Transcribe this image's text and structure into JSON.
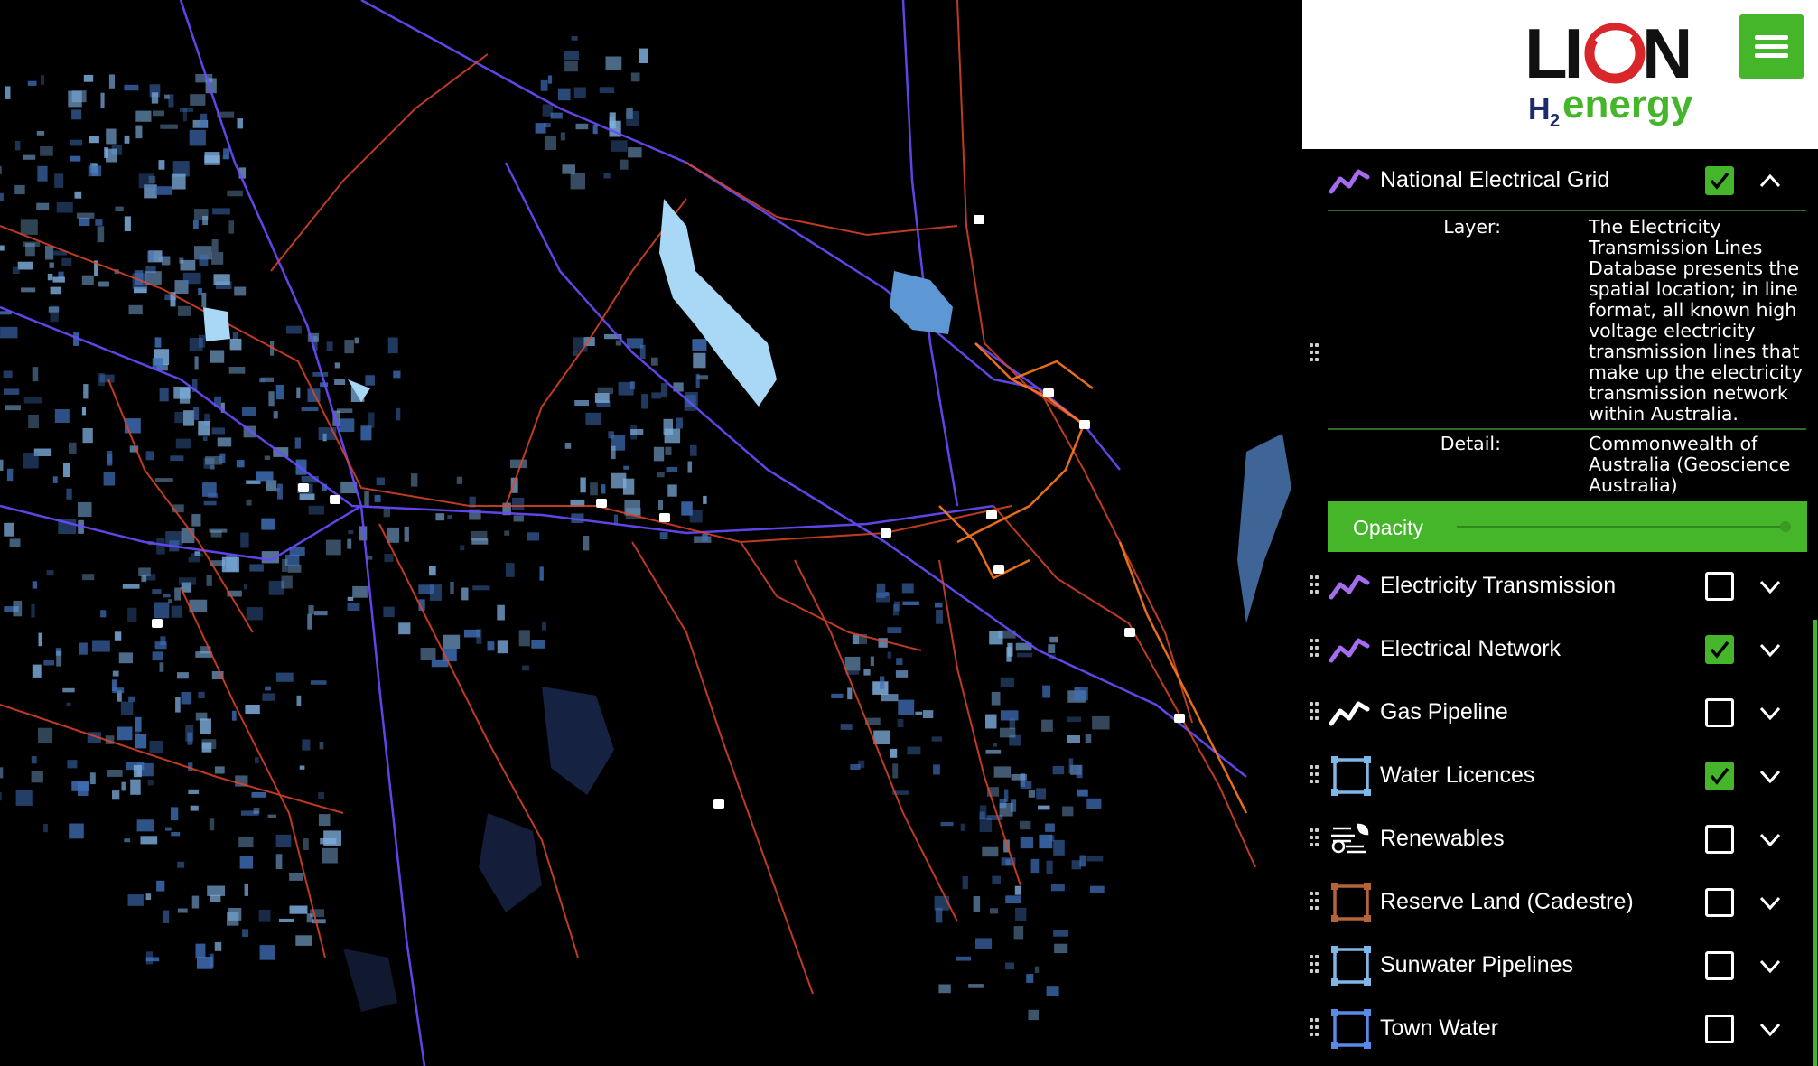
{
  "brand": {
    "name": "LION",
    "sub_h": "H",
    "sub_2": "2",
    "sub_energy": "energy",
    "accent": "#45b52a",
    "logo_red": "#d8262b"
  },
  "menu": {
    "icon": "hamburger-menu-icon"
  },
  "expanded_layer": {
    "name": "National Electrical Grid",
    "checked": true,
    "icon": "line-layer-icon",
    "icon_color": "#a66cf0",
    "layer_label": "Layer:",
    "layer_lines": [
      "The Electricity",
      "Transmission Lines",
      "Database presents the",
      "spatial location; in line",
      "format, all known high",
      "voltage electricity",
      "transmission lines that",
      "make up the electricity",
      "transmission network",
      "within Australia."
    ],
    "detail_label": "Detail:",
    "detail_lines": [
      "Commonwealth of",
      "Australia (Geoscience",
      "Australia)"
    ],
    "opacity_label": "Opacity",
    "opacity": 1.0
  },
  "layers": [
    {
      "name": "Electricity Transmission",
      "checked": false,
      "icon": "line-layer-icon",
      "icon_color": "#a66cf0"
    },
    {
      "name": "Electrical Network",
      "checked": true,
      "icon": "line-layer-icon",
      "icon_color": "#a66cf0"
    },
    {
      "name": "Gas Pipeline",
      "checked": false,
      "icon": "line-layer-icon",
      "icon_color": "#ffffff"
    },
    {
      "name": "Water Licences",
      "checked": true,
      "icon": "polygon-layer-icon",
      "icon_color": "#7fb8e8"
    },
    {
      "name": "Renewables",
      "checked": false,
      "icon": "renewables-icon",
      "icon_color": "#ffffff"
    },
    {
      "name": "Reserve Land (Cadestre)",
      "checked": false,
      "icon": "polygon-layer-icon",
      "icon_color": "#b5643a"
    },
    {
      "name": "Sunwater Pipelines",
      "checked": false,
      "icon": "polygon-layer-icon",
      "icon_color": "#7fb8e8"
    },
    {
      "name": "Town Water",
      "checked": false,
      "icon": "polygon-layer-icon",
      "icon_color": "#5a8ae8"
    }
  ],
  "map_colors": {
    "background": "#000000",
    "transmission": "#6a4cff",
    "network": "#e0452a",
    "network_bright": "#ff7a1e",
    "water_light": "#a8d8f5",
    "water_dark": "#1f2f5a",
    "parcels": "#5a8fd6"
  }
}
